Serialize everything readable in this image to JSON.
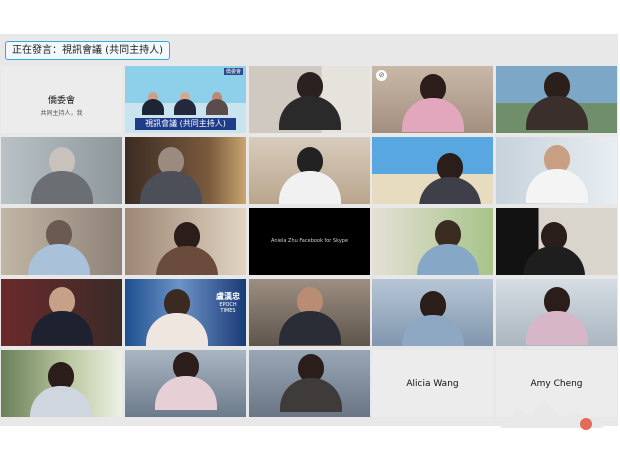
{
  "speaker_label": "正在發言：視訊會議 (共同主持人)",
  "tiles": [
    {
      "title": "僑委會",
      "subtitle": "共同主持人，我"
    },
    {
      "banner": "視訊會議 (共同主持人)",
      "logo": "僑委會"
    },
    {
      "icon": "mic-muted-icon"
    },
    {
      "caption": "Aniela Zhu Facebook for Skype"
    },
    {
      "logo_text": "盧漢忠",
      "logo_sub": "EPOCH TIMES"
    },
    {
      "name": "Alicia Wang"
    },
    {
      "name": "Amy Cheng"
    }
  ],
  "colors": {
    "speaking_outline": "#5fc3ff",
    "speaker_border": "#3aa7d8"
  }
}
